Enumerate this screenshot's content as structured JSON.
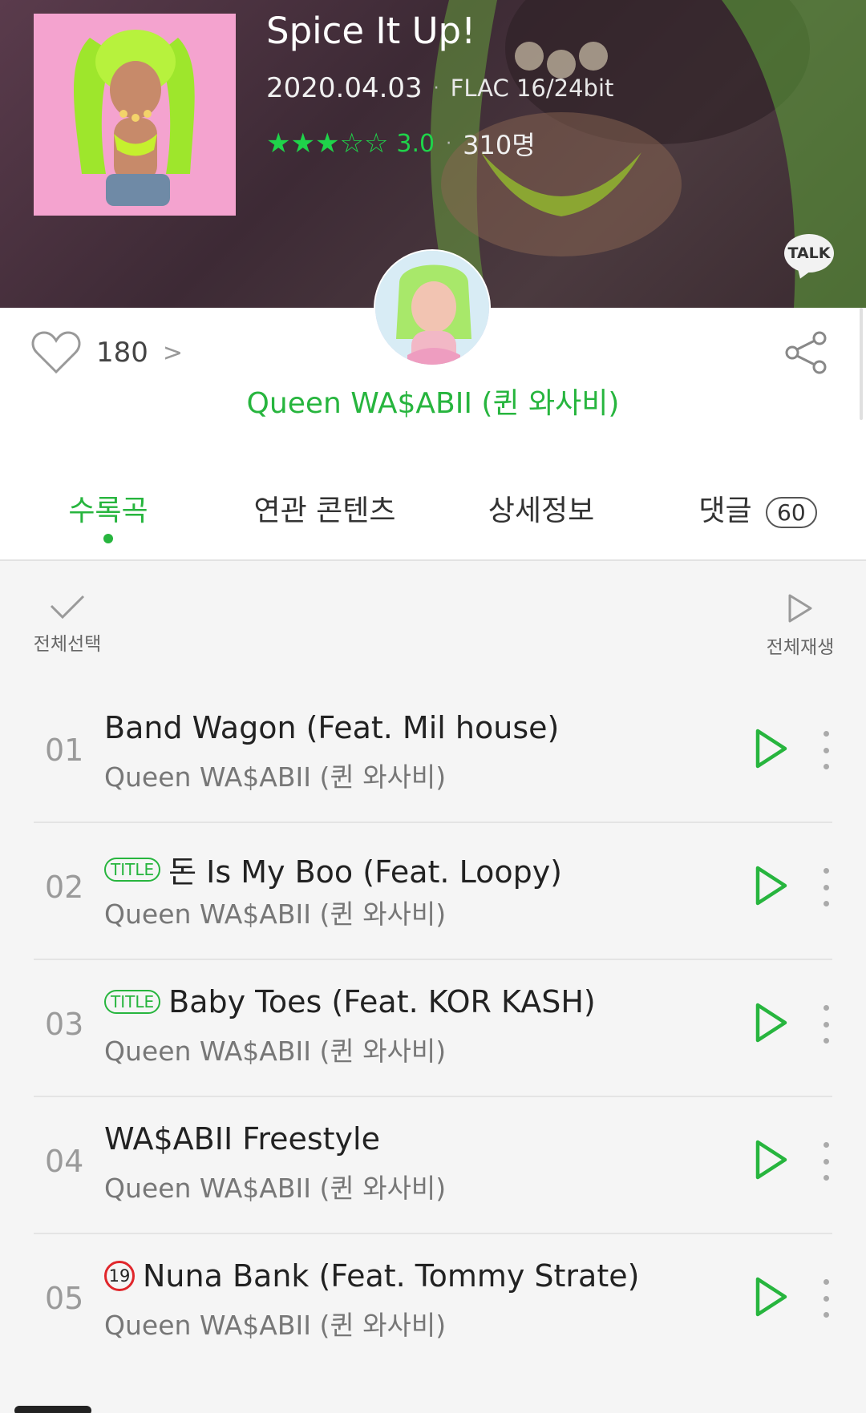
{
  "album": {
    "title": "Spice It Up!",
    "date": "2020.04.03",
    "format": "FLAC 16/24bit",
    "rating_value": 3.0,
    "rating_text": "3.0",
    "rating_count": "310명",
    "stars_filled": 3,
    "stars_total": 5,
    "talk_label": "TALK"
  },
  "likes": {
    "count": "180",
    "chevron": ">"
  },
  "artist": {
    "name": "Queen WA$ABII (퀸 와사비)"
  },
  "tabs": [
    {
      "label": "수록곡",
      "active": true
    },
    {
      "label": "연관 콘텐츠",
      "active": false
    },
    {
      "label": "상세정보",
      "active": false
    },
    {
      "label": "댓글",
      "badge": "60",
      "active": false
    }
  ],
  "controls": {
    "select_all": "전체선택",
    "play_all": "전체재생"
  },
  "tracks": [
    {
      "num": "01",
      "title": "Band Wagon (Feat. Mil house)",
      "artist": "Queen WA$ABII (퀸 와사비)",
      "badge": ""
    },
    {
      "num": "02",
      "title": "돈 Is My Boo (Feat. Loopy)",
      "artist": "Queen WA$ABII (퀸 와사비)",
      "badge": "TITLE"
    },
    {
      "num": "03",
      "title": "Baby Toes (Feat. KOR KASH)",
      "artist": "Queen WA$ABII (퀸 와사비)",
      "badge": "TITLE"
    },
    {
      "num": "04",
      "title": "WA$ABII Freestyle",
      "artist": "Queen WA$ABII (퀸 와사비)",
      "badge": ""
    },
    {
      "num": "05",
      "title": "Nuna Bank (Feat. Tommy Strate)",
      "artist": "Queen WA$ABII (퀸 와사비)",
      "badge": "19"
    }
  ],
  "colors": {
    "accent": "#27b53e",
    "star": "#1fd34a",
    "age_red": "#e0262b"
  }
}
